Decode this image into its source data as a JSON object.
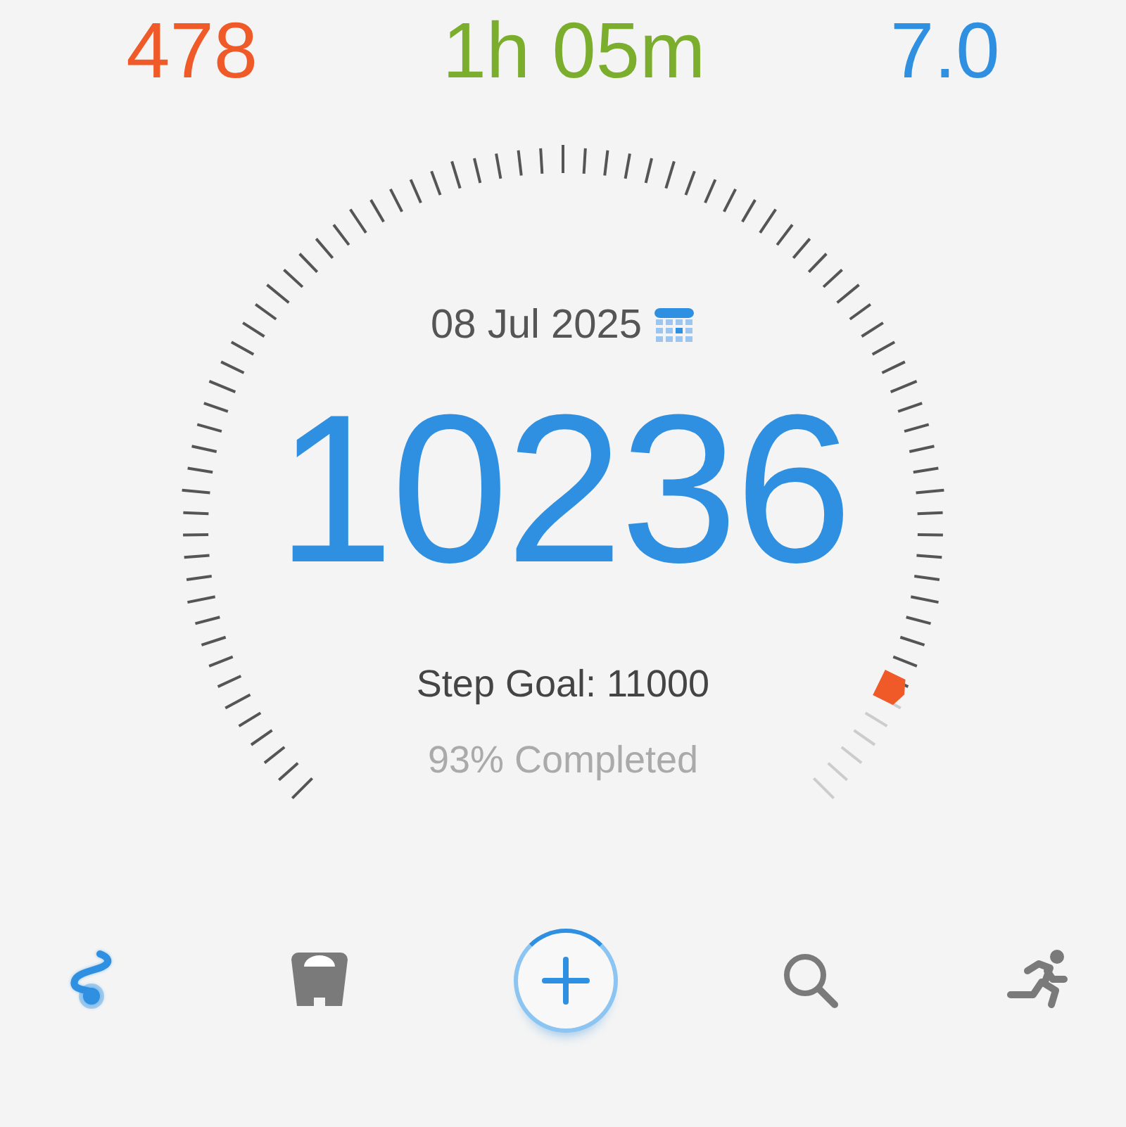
{
  "stats": [
    {
      "value": "478",
      "color": "#f05a28"
    },
    {
      "value": "1h 05m",
      "color": "#7cae2e"
    },
    {
      "value": "7.0",
      "color": "#2f8fe0"
    }
  ],
  "gauge": {
    "date": "08 Jul 2025",
    "steps": "10236",
    "goal": "Step Goal: 11000",
    "completed": "93% Completed"
  },
  "nav": [
    {
      "kind": "route",
      "selected": true
    },
    {
      "kind": "scale",
      "selected": false
    },
    {
      "kind": "add",
      "selected": false
    },
    {
      "kind": "search",
      "selected": false
    },
    {
      "kind": "runner",
      "selected": false
    }
  ]
}
